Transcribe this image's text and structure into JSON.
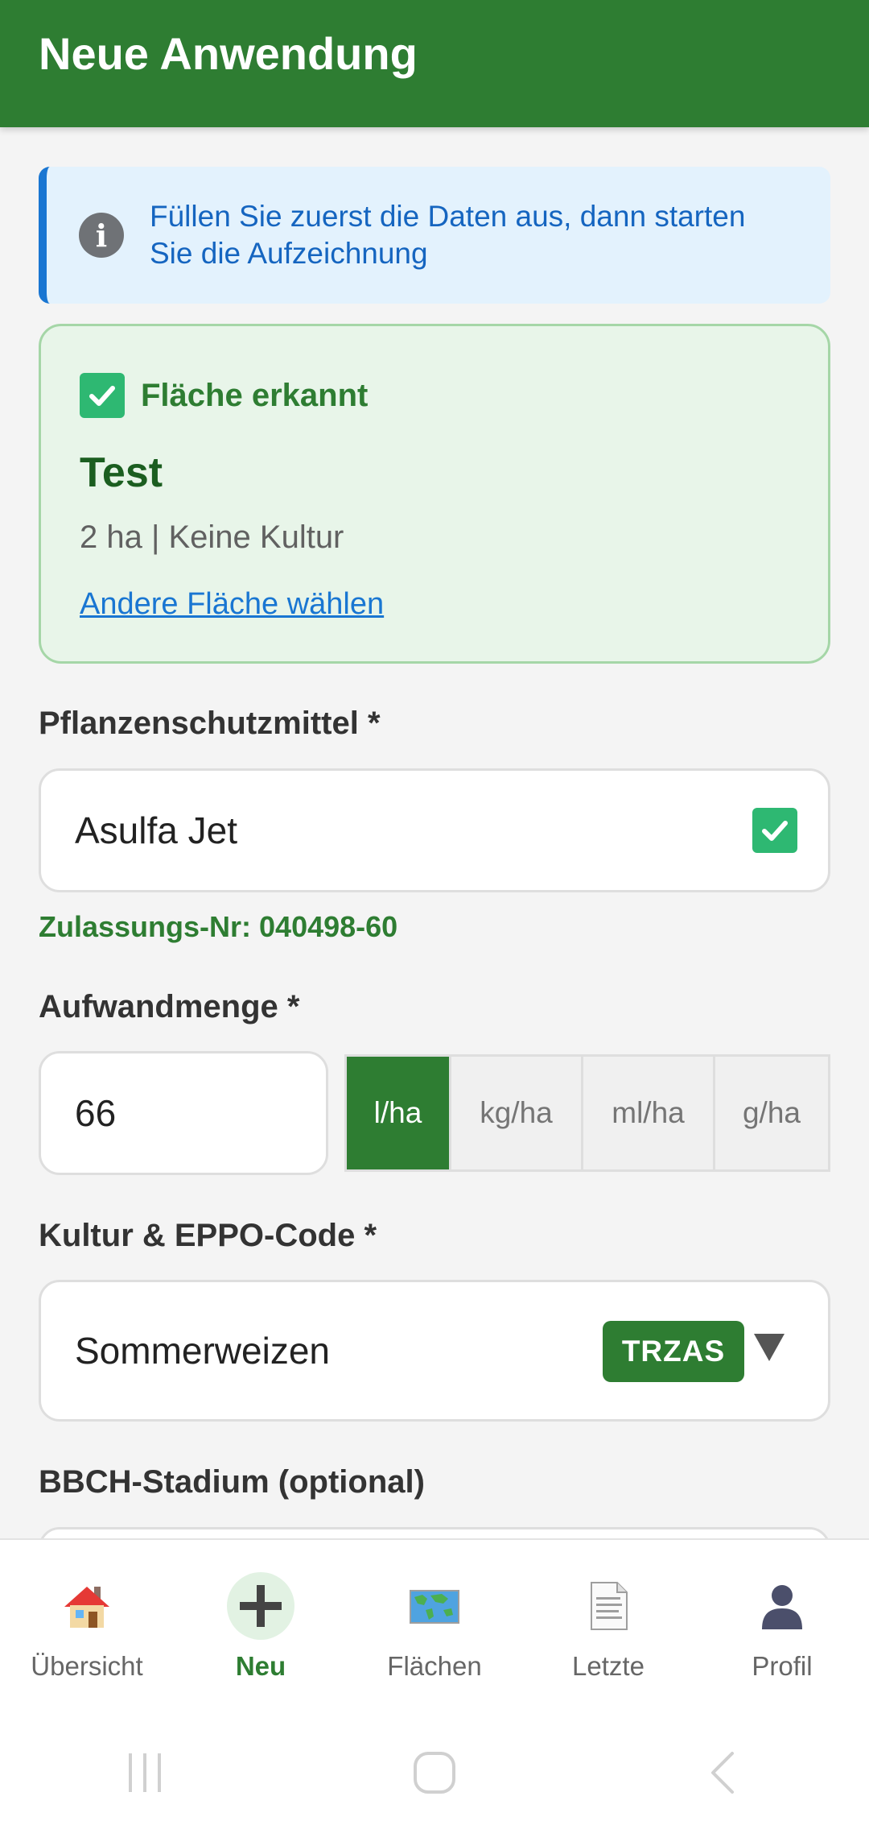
{
  "appbar": {
    "title": "Neue Anwendung"
  },
  "info": {
    "icon": "info-icon",
    "text": "Füllen Sie zuerst die Daten aus, dann starten Sie die Aufzeichnung"
  },
  "field_card": {
    "status_label": "Fläche erkannt",
    "name": "Test",
    "meta": "2 ha | Keine Kultur",
    "change_link": "Andere Fläche wählen"
  },
  "product": {
    "label": "Pflanzenschutzmittel *",
    "value": "Asulfa Jet",
    "approval": "Zulassungs-Nr: 040498-60"
  },
  "amount": {
    "label": "Aufwandmenge *",
    "value": "66",
    "units": [
      "l/ha",
      "kg/ha",
      "ml/ha",
      "g/ha"
    ],
    "selected_unit": "l/ha"
  },
  "crop": {
    "label": "Kultur & EPPO-Code *",
    "value": "Sommerweizen",
    "eppo": "TRZAS"
  },
  "bbch": {
    "label": "BBCH-Stadium (optional)"
  },
  "bottom_nav": {
    "items": [
      {
        "label": "Übersicht",
        "icon": "house-icon"
      },
      {
        "label": "Neu",
        "icon": "plus-icon"
      },
      {
        "label": "Flächen",
        "icon": "world-map-icon"
      },
      {
        "label": "Letzte",
        "icon": "document-icon"
      },
      {
        "label": "Profil",
        "icon": "person-icon"
      }
    ],
    "active": "Neu"
  },
  "colors": {
    "primary": "#2e7d32",
    "info_bg": "#e3f2fd",
    "info_accent": "#1976d2",
    "success_bg": "#e8f5e9"
  }
}
